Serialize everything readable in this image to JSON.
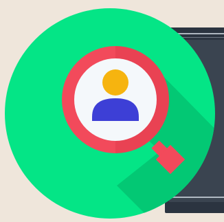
{
  "colors": {
    "background": "#efe6db",
    "frame_dark": "#2b3440",
    "frame_mid": "#3a4450",
    "frame_stripe": "#cfd8e0",
    "circle_green": "#04e586",
    "shadow_green": "#03c874",
    "lens_ring": "#f24a5b",
    "lens_ring_dark": "#d93344",
    "lens_face": "#f4f8fb",
    "handle": "#f24a5b",
    "avatar_head": "#f6b40f",
    "avatar_body": "#3d3fd6"
  },
  "icons": {
    "main": "search-user-icon",
    "avatar": "user-avatar-icon",
    "magnifier": "magnifying-glass-icon"
  }
}
